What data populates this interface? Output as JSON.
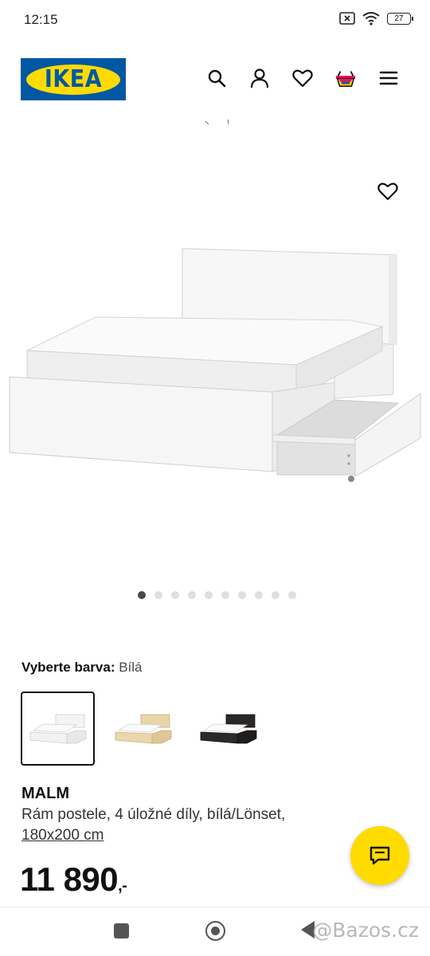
{
  "status_bar": {
    "time": "12:15",
    "battery": "27"
  },
  "header": {
    "logo_text": "IKEA"
  },
  "gallery": {
    "dot_count": 10,
    "active_index": 0
  },
  "color": {
    "label": "Vyberte barva:",
    "value": "Bílá",
    "swatches": [
      "white",
      "white-oak",
      "black-brown"
    ],
    "selected": 0
  },
  "product": {
    "name": "MALM",
    "description": "Rám postele, 4 úložné díly, bílá/Lönset,",
    "size": "180x200 cm",
    "price": "11 890",
    "price_suffix": ",-"
  },
  "watermark": "@Bazos.cz",
  "colors": {
    "ikea_blue": "#0058a3",
    "ikea_yellow": "#ffdb00"
  }
}
